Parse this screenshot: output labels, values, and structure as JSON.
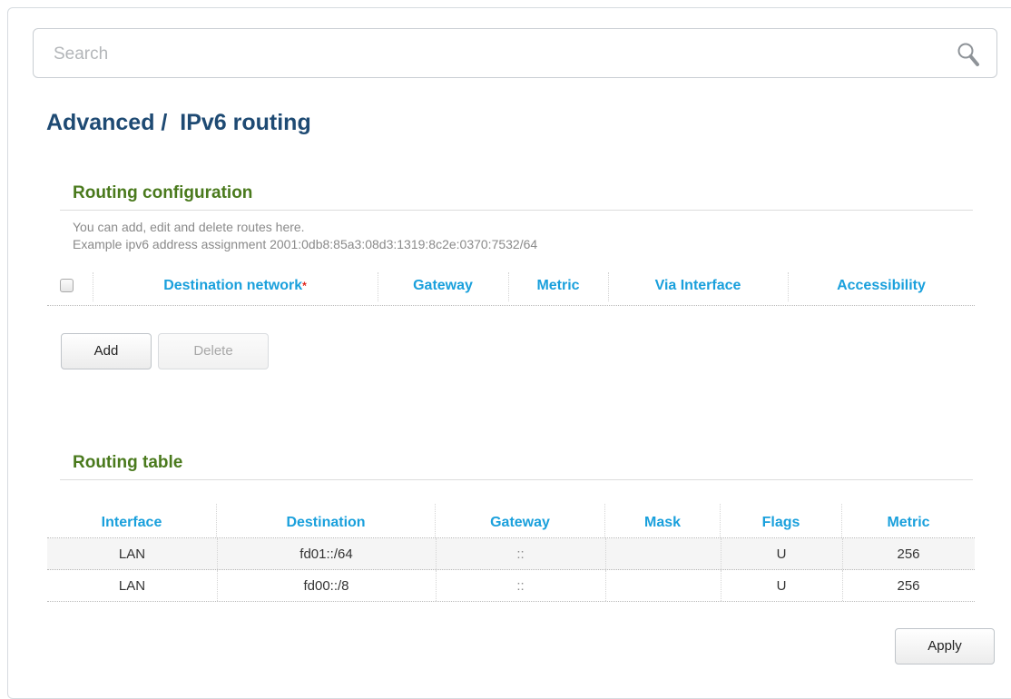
{
  "search": {
    "placeholder": "Search"
  },
  "page_title": "Advanced /  IPv6 routing",
  "routing_configuration": {
    "title": "Routing configuration",
    "hint_line1": "You can add, edit and delete routes here.",
    "hint_line2": "Example ipv6 address assignment 2001:0db8:85a3:08d3:1319:8c2e:0370:7532/64",
    "columns": {
      "destination_network": "Destination network",
      "required_mark": "*",
      "gateway": "Gateway",
      "metric": "Metric",
      "via_interface": "Via Interface",
      "accessibility": "Accessibility"
    },
    "add_label": "Add",
    "delete_label": "Delete"
  },
  "routing_table": {
    "title": "Routing table",
    "columns": [
      "Interface",
      "Destination",
      "Gateway",
      "Mask",
      "Flags",
      "Metric"
    ],
    "rows": [
      [
        "LAN",
        "fd01::/64",
        "::",
        "",
        "U",
        "256"
      ],
      [
        "LAN",
        "fd00::/8",
        "::",
        "",
        "U",
        "256"
      ]
    ]
  },
  "apply_label": "Apply",
  "colors": {
    "title_blue": "#1e4a73",
    "section_green": "#4a7a1d",
    "column_blue": "#1aa0dc",
    "required_red": "#e0241b"
  }
}
